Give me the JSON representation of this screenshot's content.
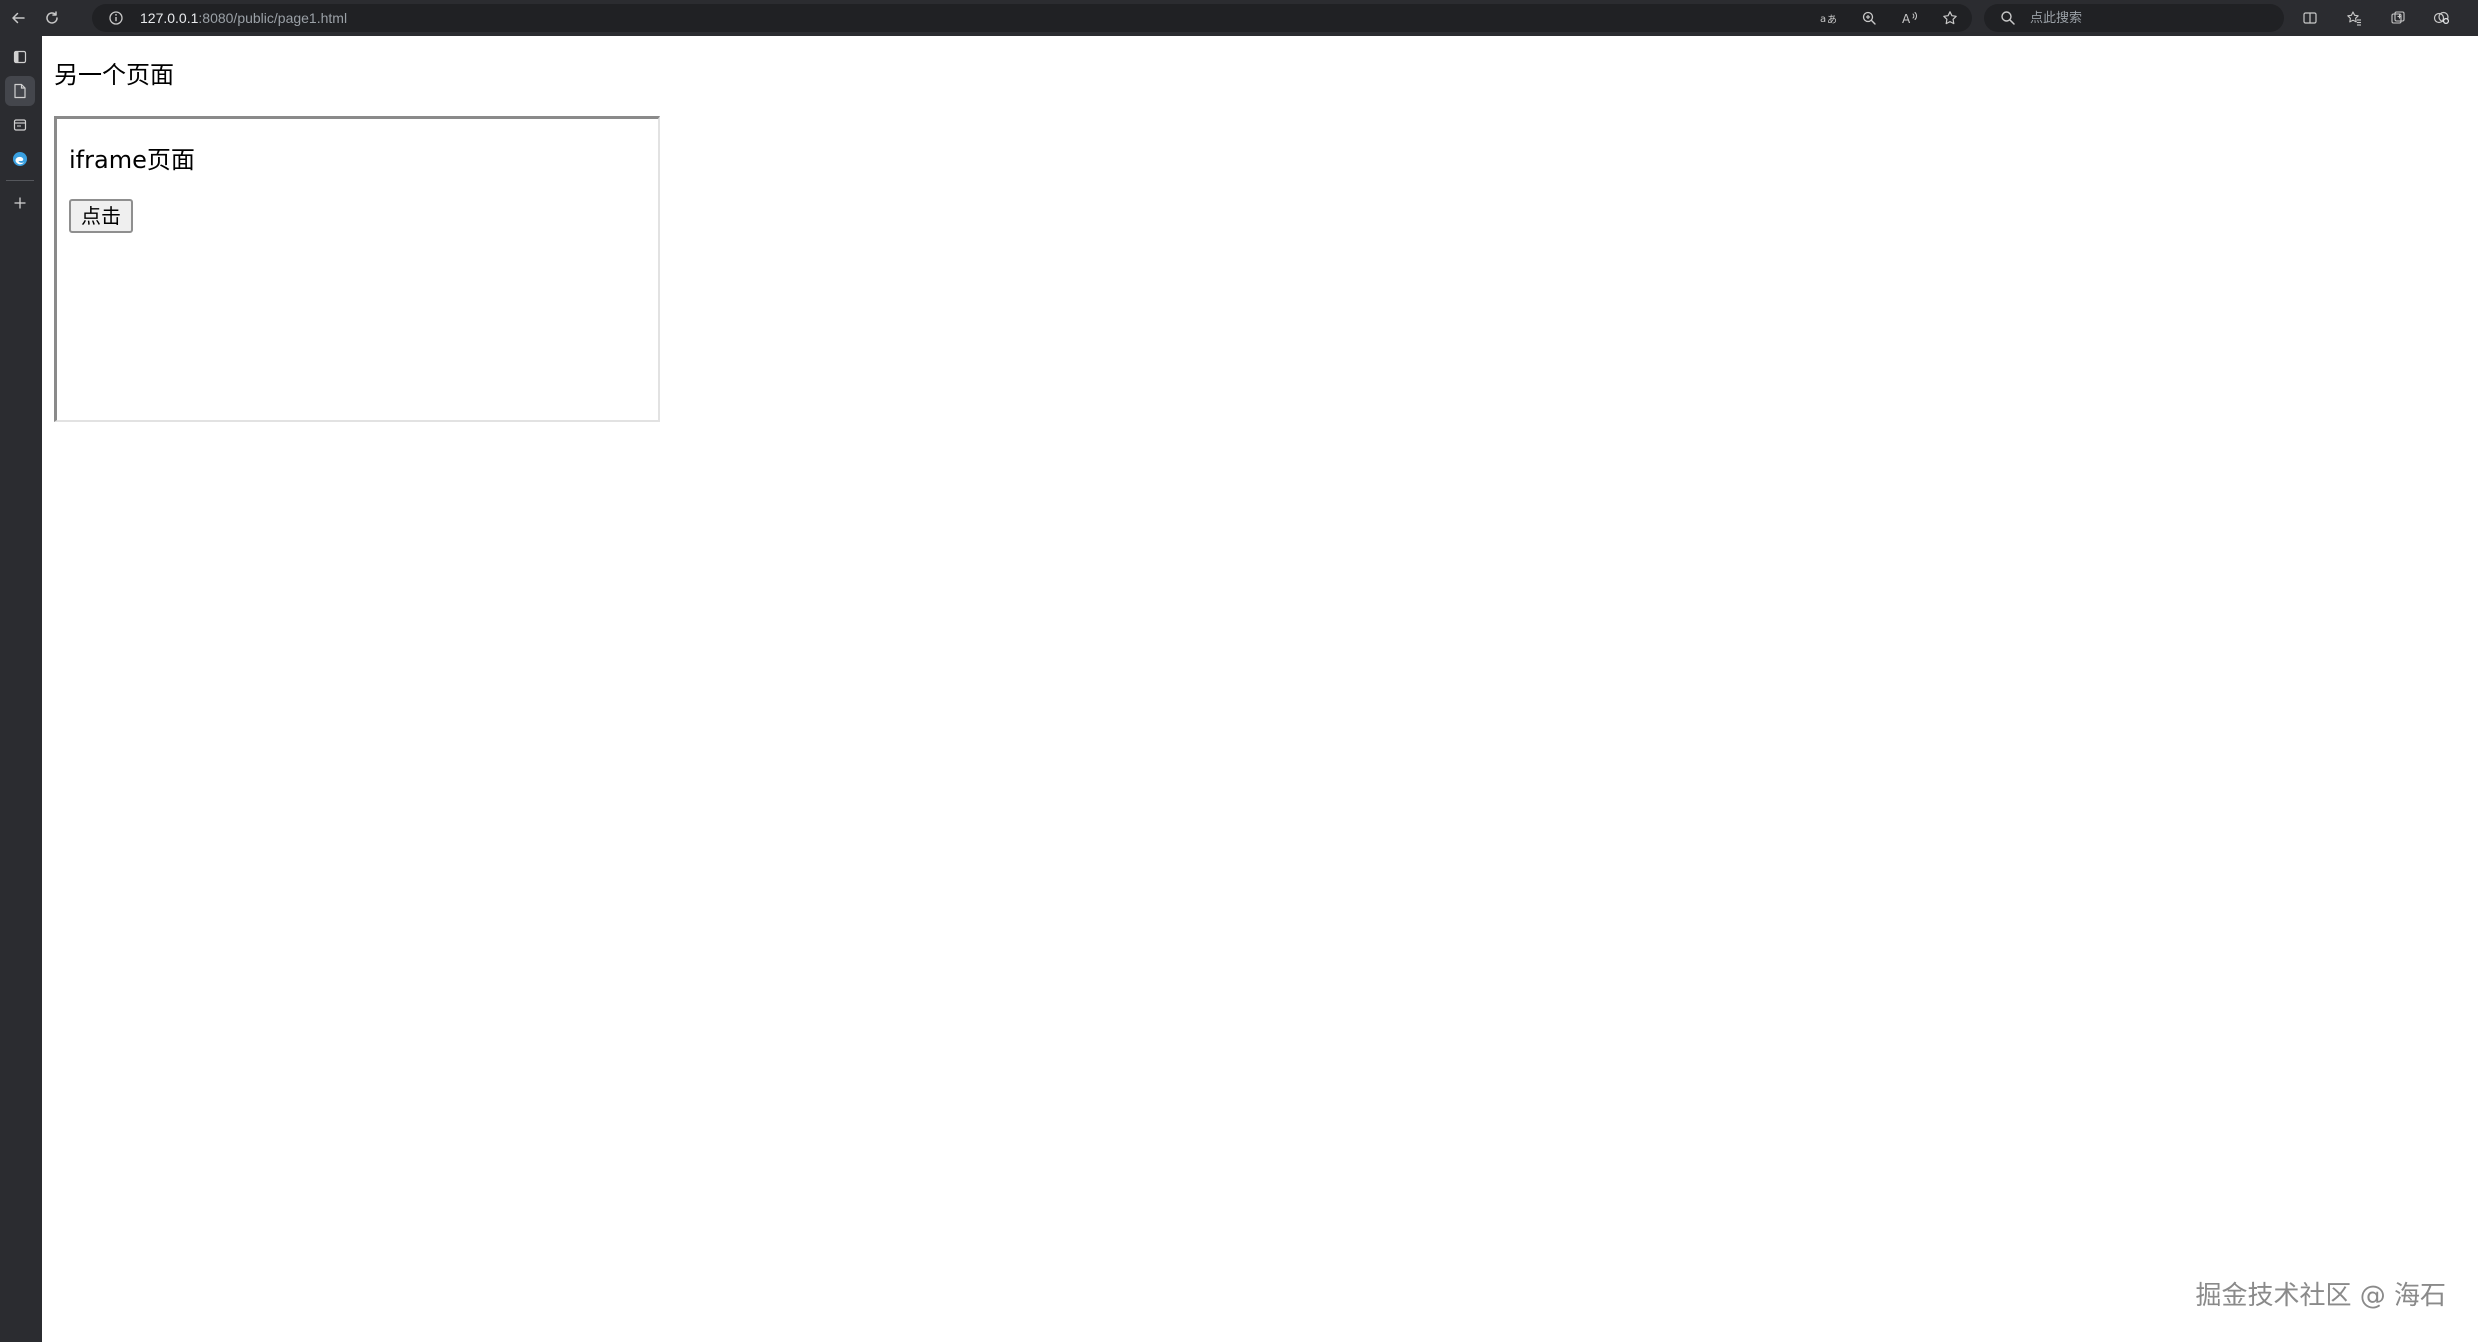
{
  "browser": {
    "url_host": "127.0.0.1",
    "url_path": ":8080/public/page1.html",
    "search_placeholder": "点此搜索",
    "icons": {
      "back": "back-arrow-icon",
      "reload": "reload-icon",
      "site_info": "info-icon",
      "translate": "translate-icon",
      "zoom": "zoom-icon",
      "read_aloud": "read-aloud-icon",
      "favorite": "star-icon",
      "search": "search-icon",
      "split_screen": "split-screen-icon",
      "favorites": "favorites-icon",
      "collections": "collections-icon",
      "extensions": "extensions-icon"
    }
  },
  "sidebar": {
    "items": [
      {
        "icon": "tab-actions-icon",
        "active": false
      },
      {
        "icon": "page-icon",
        "active": true
      },
      {
        "icon": "tab-icon",
        "active": false
      },
      {
        "icon": "edge-logo-icon",
        "active": false
      },
      {
        "icon": "add-icon",
        "active": false
      }
    ]
  },
  "page": {
    "title": "另一个页面",
    "iframe": {
      "title": "iframe页面",
      "button_label": "点击"
    },
    "watermark": "掘金技术社区 @ 海石"
  },
  "colors": {
    "chrome_bg": "#2b2c30",
    "omnibox_bg": "#202124",
    "page_bg": "#ffffff",
    "iframe_border": "#8a8a8a"
  }
}
